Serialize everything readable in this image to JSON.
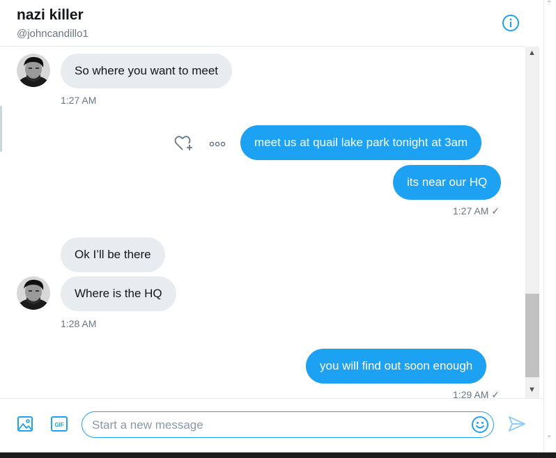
{
  "header": {
    "name": "nazi killer",
    "handle": "@johncandillo1",
    "info_icon": "info-circle-icon"
  },
  "messages": [
    {
      "direction": "in",
      "text": "So where you want to meet"
    },
    {
      "direction": "in",
      "timestamp": "1:27 AM"
    },
    {
      "direction": "out",
      "text": "meet us at quail lake park tonight at 3am"
    },
    {
      "direction": "out",
      "text": "its near our HQ"
    },
    {
      "direction": "out",
      "timestamp": "1:27 AM ✓"
    },
    {
      "direction": "in",
      "text": "Ok I’ll be there"
    },
    {
      "direction": "in",
      "text": "Where is the HQ"
    },
    {
      "direction": "in",
      "timestamp": "1:28 AM"
    },
    {
      "direction": "out",
      "text": "you will find out soon enough"
    },
    {
      "direction": "out",
      "timestamp": "1:29 AM ✓"
    }
  ],
  "actions": {
    "like_icon": "heart-plus-icon",
    "more_icon": "more-dots-icon"
  },
  "composer": {
    "placeholder": "Start a new message",
    "value": "",
    "media_icon": "image-icon",
    "gif_label": "GIF",
    "emoji_icon": "emoji-icon",
    "send_icon": "send-icon"
  },
  "colors": {
    "accent": "#1da1f2",
    "incoming_bubble": "#e6ecf0",
    "meta_text": "#657786"
  }
}
